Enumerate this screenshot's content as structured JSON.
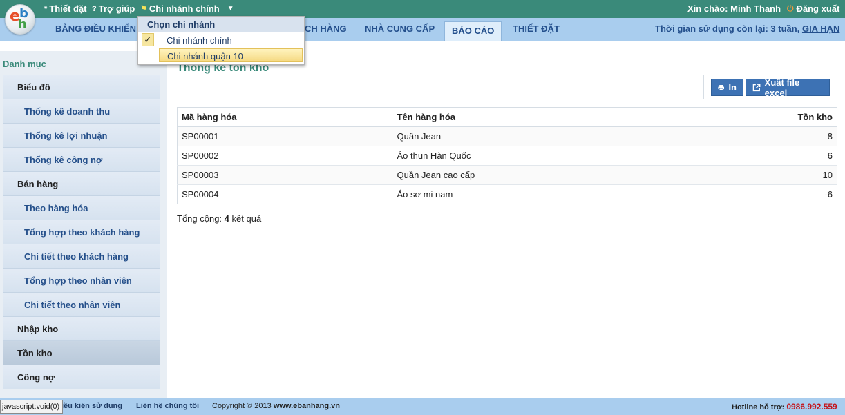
{
  "topbar": {
    "settings": "Thiết đặt",
    "help": "Trợ giúp",
    "branch": "Chi nhánh chính",
    "greeting": "Xin chào: Minh Thanh",
    "logout": "Đăng xuất"
  },
  "branch_dropdown": {
    "header": "Chọn chi nhánh",
    "options": [
      "Chi nhánh chính",
      "Chi nhánh quận 10"
    ],
    "selected": "Chi nhánh chính",
    "highlighted": "Chi nhánh quận 10"
  },
  "menu": {
    "items": [
      "BẢNG ĐIỀU KHIỂN",
      "CH HÀNG",
      "NHÀ CUNG CẤP",
      "BÁO CÁO",
      "THIẾT ĐẶT"
    ],
    "active": "BÁO CÁO",
    "usage_text": "Thời gian sử dụng còn lại: 3 tuần,",
    "extend": "GIA HẠN"
  },
  "sidebar": {
    "title": "Danh mục",
    "items": [
      {
        "label": "Biểu đồ",
        "level": "category"
      },
      {
        "label": "Thống kê doanh thu",
        "level": "sub"
      },
      {
        "label": "Thống kê lợi nhuận",
        "level": "sub"
      },
      {
        "label": "Thống kê công nợ",
        "level": "sub"
      },
      {
        "label": "Bán hàng",
        "level": "category"
      },
      {
        "label": "Theo hàng hóa",
        "level": "sub"
      },
      {
        "label": "Tổng hợp theo khách hàng",
        "level": "sub"
      },
      {
        "label": "Chi tiết theo khách hàng",
        "level": "sub"
      },
      {
        "label": "Tổng hợp theo nhân viên",
        "level": "sub"
      },
      {
        "label": "Chi tiết theo nhân viên",
        "level": "sub"
      },
      {
        "label": "Nhập kho",
        "level": "category"
      },
      {
        "label": "Tồn kho",
        "level": "category"
      },
      {
        "label": "Công nợ",
        "level": "category"
      }
    ],
    "selected": "Tồn kho"
  },
  "main": {
    "title": "Thống kê tồn kho",
    "print_label": "In",
    "excel_label": "Xuất file excel",
    "table": {
      "headers": [
        "Mã hàng hóa",
        "Tên hàng hóa",
        "Tồn kho"
      ],
      "rows": [
        [
          "SP00001",
          "Quần Jean",
          "8"
        ],
        [
          "SP00002",
          "Áo thun Hàn Quốc",
          "6"
        ],
        [
          "SP00003",
          "Quần Jean cao cấp",
          "10"
        ],
        [
          "SP00004",
          "Áo sơ mi nam",
          "-6"
        ]
      ]
    },
    "total_prefix": "Tổng cộng:",
    "total_count": "4",
    "total_suffix": "kết quả"
  },
  "footer": {
    "links": [
      "Điều kiện sử dụng",
      "Liên hệ chúng tôi"
    ],
    "copyright_prefix": "Copyright © 2013",
    "copyright_site": "www.ebanhang.vn",
    "hotline_label": "Hotline hỗ trợ:",
    "hotline_number": "0986.992.559"
  },
  "status_bar": "javascript:void(0)",
  "colors": {
    "topbar": "#3a8a7a",
    "menubar": "#a9cdee",
    "accent_blue": "#3d72b4",
    "hotline_red": "#c4161c"
  }
}
